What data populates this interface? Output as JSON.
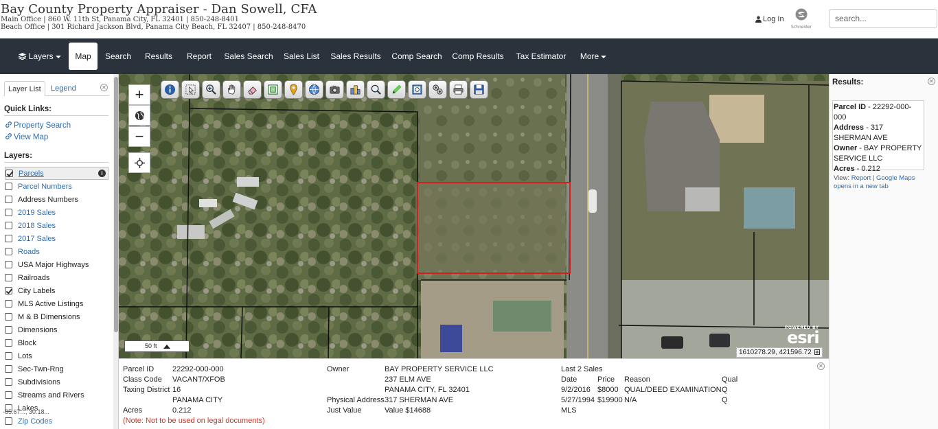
{
  "header": {
    "title": "Bay County Property Appraiser - Dan Sowell, CFA",
    "main_office": "Main Office | 860 W. 11th St, Panama City, FL 32401 | 850-248-8401",
    "beach_office": "Beach Office | 301 Richard Jackson Blvd, Panama City Beach, FL 32407 | 850-248-8470",
    "login_label": "Log In",
    "logo_text": "Schneider",
    "search_placeholder": "search..."
  },
  "nav": {
    "layers": "Layers",
    "map": "Map",
    "search": "Search",
    "results": "Results",
    "report": "Report",
    "sales_search": "Sales Search",
    "sales_list": "Sales List",
    "sales_results": "Sales Results",
    "comp_search": "Comp Search",
    "comp_results": "Comp Results",
    "tax_estimator": "Tax Estimator",
    "more": "More",
    "active": "Map"
  },
  "left_panel": {
    "tabs": [
      "Layer List",
      "Legend"
    ],
    "quick_links_heading": "Quick Links:",
    "quick_links": [
      "Property Search",
      "View Map"
    ],
    "layers_heading": "Layers:",
    "layers": [
      {
        "label": "Parcels",
        "checked": true,
        "style": "blue",
        "selected": true
      },
      {
        "label": "Parcel Numbers",
        "checked": false,
        "style": "blue"
      },
      {
        "label": "Address Numbers",
        "checked": false,
        "style": "dark"
      },
      {
        "label": "2019 Sales",
        "checked": false,
        "style": "blue"
      },
      {
        "label": "2018 Sales",
        "checked": false,
        "style": "blue"
      },
      {
        "label": "2017 Sales",
        "checked": false,
        "style": "blue"
      },
      {
        "label": "Roads",
        "checked": false,
        "style": "blue"
      },
      {
        "label": "USA Major Highways",
        "checked": false,
        "style": "dark"
      },
      {
        "label": "Railroads",
        "checked": false,
        "style": "dark"
      },
      {
        "label": "City Labels",
        "checked": true,
        "style": "dark"
      },
      {
        "label": "MLS Active Listings",
        "checked": false,
        "style": "dark"
      },
      {
        "label": "M & B Dimensions",
        "checked": false,
        "style": "dark"
      },
      {
        "label": "Dimensions",
        "checked": false,
        "style": "dark"
      },
      {
        "label": "Block",
        "checked": false,
        "style": "dark"
      },
      {
        "label": "Lots",
        "checked": false,
        "style": "dark"
      },
      {
        "label": "Sec-Twn-Rng",
        "checked": false,
        "style": "dark"
      },
      {
        "label": "Subdivisions",
        "checked": false,
        "style": "dark"
      },
      {
        "label": "Streams and Rivers",
        "checked": false,
        "style": "dark"
      },
      {
        "label": "Lakes",
        "checked": false,
        "style": "dark"
      },
      {
        "label": "Zip Codes",
        "checked": false,
        "style": "blue"
      }
    ],
    "overlay_coords": "-85.67..., 30.18..."
  },
  "map": {
    "scale_label": "50 ft",
    "esri_powered": "POWERED BY",
    "esri_logo": "esri",
    "coordinates": "1610278.29, 421596.72",
    "tools": [
      "info-icon",
      "select-icon",
      "zoom-in-tool-icon",
      "pan-icon",
      "eraser-icon",
      "extent-icon",
      "pin-icon",
      "globe-icon",
      "camera-icon",
      "buildings-icon",
      "search-tool-icon",
      "pencil-icon",
      "print-preview-icon",
      "measure-icon",
      "print-icon",
      "save-icon"
    ]
  },
  "info_panel": {
    "labels": {
      "parcel_id": "Parcel ID",
      "class_code": "Class Code",
      "taxing_district": "Taxing District",
      "acres": "Acres",
      "owner": "Owner",
      "physical_address": "Physical Address",
      "just_value": "Just Value",
      "last_sales": "Last 2 Sales",
      "date": "Date",
      "price": "Price",
      "reason": "Reason",
      "qual": "Qual",
      "mls": "MLS"
    },
    "values": {
      "parcel_id": "22292-000-000",
      "class_code": "VACANT/XFOB",
      "taxing_district": "16",
      "taxing_city": "PANAMA CITY",
      "acres": "0.212",
      "owner_name": "BAY PROPERTY SERVICE LLC",
      "owner_street": "237 ELM AVE",
      "owner_city": "PANAMA CITY, FL 32401",
      "physical_address": "317 SHERMAN AVE",
      "just_value": "Value $14688"
    },
    "sales": [
      {
        "date": "9/2/2016",
        "price": "$8000",
        "reason": "QUAL/DEED EXAMINATION",
        "qual": "Q"
      },
      {
        "date": "5/27/1994",
        "price": "$19900",
        "reason": "N/A",
        "qual": "Q"
      }
    ],
    "note": "(Note: Not to be used on legal documents)"
  },
  "results_panel": {
    "heading": "Results:",
    "parcel_label": "Parcel ID",
    "parcel_value": "22292-000-000",
    "address_label": "Address",
    "address_value": "317 SHERMAN AVE",
    "owner_label": "Owner",
    "owner_value": "BAY PROPERTY SERVICE LLC",
    "acres_label": "Acres",
    "acres_value": "0.212",
    "view_label": "View:",
    "report_link": "Report",
    "gmaps_link": "Google Maps opens in a new tab"
  },
  "colors": {
    "nav_bg": "#2a323c",
    "link": "#2a6db5",
    "parcel_highlight": "#d32020"
  }
}
